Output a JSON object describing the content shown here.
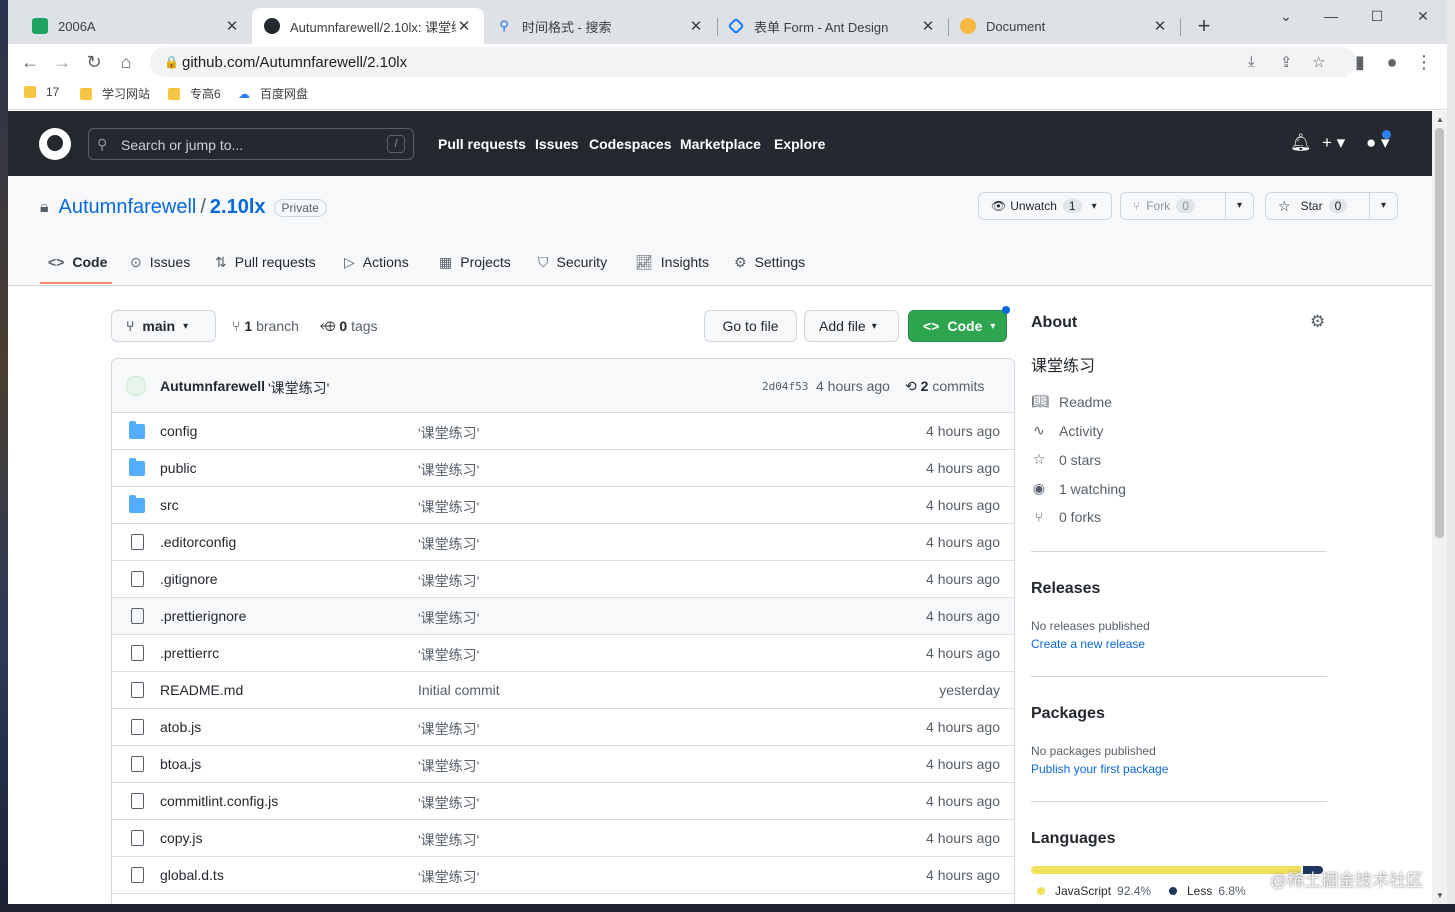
{
  "browser": {
    "tabs": [
      {
        "title": "2006A",
        "active": false
      },
      {
        "title": "Autumnfarewell/2.10lx: 课堂练",
        "active": true
      },
      {
        "title": "时间格式 - 搜索",
        "active": false
      },
      {
        "title": "表单 Form - Ant Design",
        "active": false
      },
      {
        "title": "Document",
        "active": false
      }
    ],
    "url": "github.com/Autumnfarewell/2.10lx",
    "bookmarks": [
      "17",
      "学习网站",
      "专高6",
      "百度网盘"
    ]
  },
  "header": {
    "search_placeholder": "Search or jump to...",
    "search_key": "/",
    "nav": [
      "Pull requests",
      "Issues",
      "Codespaces",
      "Marketplace",
      "Explore"
    ]
  },
  "repo": {
    "owner": "Autumnfarewell",
    "separator": "/",
    "name": "2.10lx",
    "visibility": "Private",
    "unwatch_label": "Unwatch",
    "unwatch_count": "1",
    "fork_label": "Fork",
    "fork_count": "0",
    "star_label": "Star",
    "star_count": "0",
    "tabs": [
      "Code",
      "Issues",
      "Pull requests",
      "Actions",
      "Projects",
      "Security",
      "Insights",
      "Settings"
    ]
  },
  "toolbar": {
    "branch": "main",
    "branch_count": "1",
    "branch_word": "branch",
    "tag_count": "0",
    "tag_word": "tags",
    "goto_file": "Go to file",
    "add_file": "Add file",
    "code": "Code"
  },
  "commit": {
    "author": "Autumnfarewell",
    "message": "'课堂练习'",
    "sha": "2d04f53",
    "time": "4 hours ago",
    "count": "2",
    "count_word": "commits"
  },
  "files": [
    {
      "name": "config",
      "type": "dir",
      "message": "'课堂练习'",
      "age": "4 hours ago"
    },
    {
      "name": "public",
      "type": "dir",
      "message": "'课堂练习'",
      "age": "4 hours ago"
    },
    {
      "name": "src",
      "type": "dir",
      "message": "'课堂练习'",
      "age": "4 hours ago"
    },
    {
      "name": ".editorconfig",
      "type": "file",
      "message": "'课堂练习'",
      "age": "4 hours ago"
    },
    {
      "name": ".gitignore",
      "type": "file",
      "message": "'课堂练习'",
      "age": "4 hours ago"
    },
    {
      "name": ".prettierignore",
      "type": "file",
      "message": "'课堂练习'",
      "age": "4 hours ago"
    },
    {
      "name": ".prettierrc",
      "type": "file",
      "message": "'课堂练习'",
      "age": "4 hours ago"
    },
    {
      "name": "README.md",
      "type": "file",
      "message": "Initial commit",
      "age": "yesterday"
    },
    {
      "name": "atob.js",
      "type": "file",
      "message": "'课堂练习'",
      "age": "4 hours ago"
    },
    {
      "name": "btoa.js",
      "type": "file",
      "message": "'课堂练习'",
      "age": "4 hours ago"
    },
    {
      "name": "commitlint.config.js",
      "type": "file",
      "message": "'课堂练习'",
      "age": "4 hours ago"
    },
    {
      "name": "copy.js",
      "type": "file",
      "message": "'课堂练习'",
      "age": "4 hours ago"
    },
    {
      "name": "global.d.ts",
      "type": "file",
      "message": "'课堂练习'",
      "age": "4 hours ago"
    }
  ],
  "about": {
    "title": "About",
    "description": "课堂练习",
    "items": [
      "Readme",
      "Activity",
      "0 stars",
      "1 watching",
      "0 forks"
    ]
  },
  "releases": {
    "title": "Releases",
    "none": "No releases published",
    "link": "Create a new release"
  },
  "packages": {
    "title": "Packages",
    "none": "No packages published",
    "link": "Publish your first package"
  },
  "languages": {
    "title": "Languages",
    "list": [
      {
        "name": "JavaScript",
        "percent": "92.4%",
        "value": 92.4,
        "color": "#f1e05a"
      },
      {
        "name": "Less",
        "percent": "6.8%",
        "value": 6.8,
        "color": "#1d365d"
      }
    ]
  },
  "watermark": "@稀土掘金技术社区",
  "colors": {
    "accent": "#0969da",
    "green": "#2da44e",
    "header": "#24292f"
  }
}
